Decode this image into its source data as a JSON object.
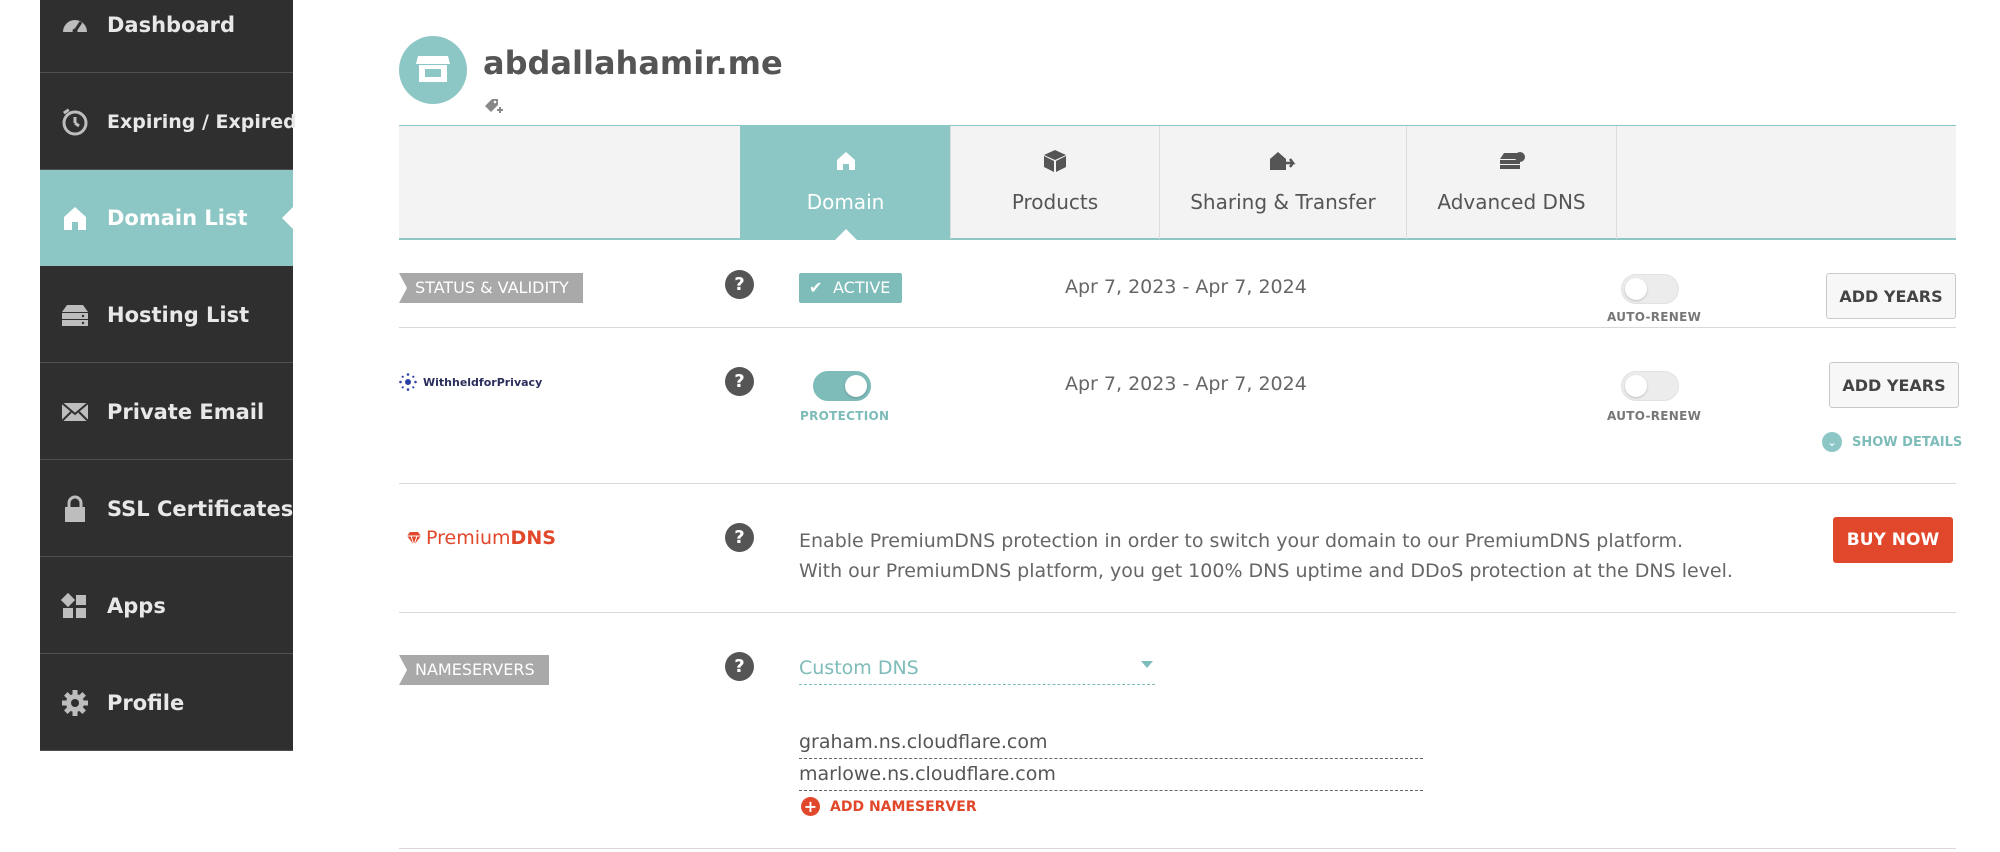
{
  "sidebar": {
    "items": [
      {
        "label": "Dashboard",
        "icon": "dashboard-gauge-icon"
      },
      {
        "label": "Expiring / Expired",
        "icon": "timer-icon"
      },
      {
        "label": "Domain List",
        "icon": "home-icon",
        "active": true
      },
      {
        "label": "Hosting List",
        "icon": "server-icon"
      },
      {
        "label": "Private Email",
        "icon": "envelope-icon"
      },
      {
        "label": "SSL Certificates",
        "icon": "lock-icon"
      },
      {
        "label": "Apps",
        "icon": "apps-grid-icon"
      },
      {
        "label": "Profile",
        "icon": "gear-icon"
      }
    ]
  },
  "header": {
    "domain_name": "abdallahamir.me",
    "avatar_icon": "storefront-icon",
    "tag_icon": "tag-add-icon"
  },
  "tabs": [
    {
      "label": "Domain",
      "icon": "home-icon",
      "active": true
    },
    {
      "label": "Products",
      "icon": "box-icon"
    },
    {
      "label": "Sharing & Transfer",
      "icon": "transfer-house-icon"
    },
    {
      "label": "Advanced DNS",
      "icon": "dns-server-icon"
    }
  ],
  "status_row": {
    "section_label": "STATUS & VALIDITY",
    "help": "?",
    "status_badge": "ACTIVE",
    "dates": "Apr 7, 2023 - Apr 7, 2024",
    "auto_renew_label": "AUTO-RENEW",
    "auto_renew_on": false,
    "button_label": "ADD YEARS"
  },
  "privacy_row": {
    "brand_label": "WithheldforPrivacy",
    "help": "?",
    "protection_label": "PROTECTION",
    "protection_on": true,
    "dates": "Apr 7, 2023 - Apr 7, 2024",
    "auto_renew_label": "AUTO-RENEW",
    "auto_renew_on": false,
    "button_label": "ADD YEARS",
    "show_details_label": "SHOW DETAILS"
  },
  "premiumdns_row": {
    "brand_prefix": "Premium",
    "brand_suffix": "DNS",
    "help": "?",
    "desc_line1": "Enable PremiumDNS protection in order to switch your domain to our PremiumDNS platform.",
    "desc_line2": "With our PremiumDNS platform, you get 100% DNS uptime and DDoS protection at the DNS level.",
    "button_label": "BUY NOW"
  },
  "nameservers_row": {
    "section_label": "NAMESERVERS",
    "help": "?",
    "dns_type": "Custom DNS",
    "nameservers": [
      "graham.ns.cloudflare.com",
      "marlowe.ns.cloudflare.com"
    ],
    "add_label": "ADD NAMESERVER"
  },
  "colors": {
    "teal": "#8cc7c5",
    "sidebar_bg": "#2f2f30",
    "accent_red": "#e1472a"
  }
}
